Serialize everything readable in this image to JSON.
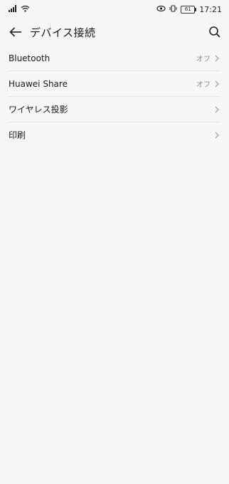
{
  "status_bar": {
    "time": "17:21",
    "battery": "61",
    "icons": [
      "signal-icon",
      "wifi-icon",
      "eye-comfort-icon",
      "vibrate-icon",
      "battery-icon"
    ]
  },
  "app_bar": {
    "title": "デバイス接続",
    "back_icon": "back-arrow-icon",
    "search_icon": "search-icon"
  },
  "items": [
    {
      "label": "Bluetooth",
      "value": "オフ"
    },
    {
      "label": "Huawei Share",
      "value": "オフ"
    },
    {
      "label": "ワイヤレス投影",
      "value": ""
    },
    {
      "label": "印刷",
      "value": ""
    }
  ],
  "colors": {
    "background": "#f6f6f6",
    "text": "#1a1a1a",
    "secondary_text": "#8a8a8a",
    "divider": "#e4e4e4"
  }
}
